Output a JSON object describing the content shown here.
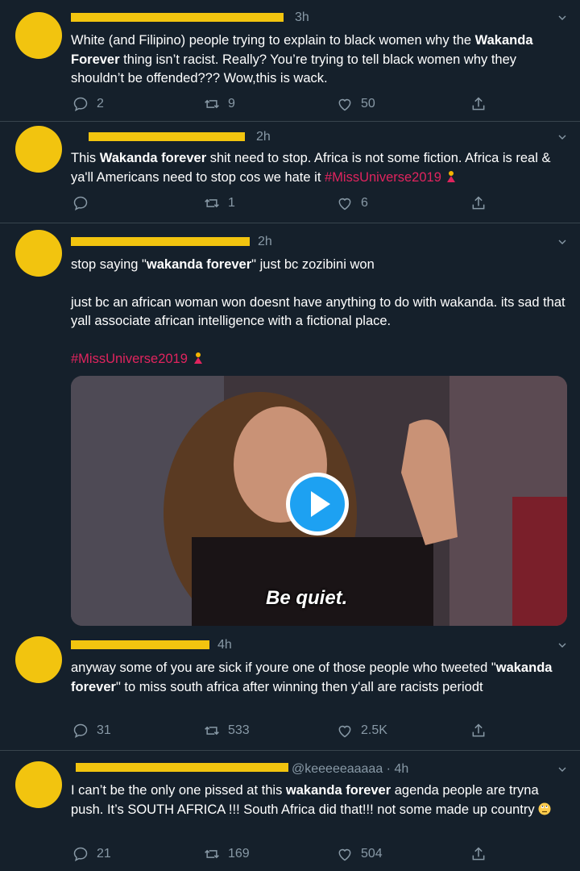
{
  "tweets": [
    {
      "time": "3h",
      "body_parts": [
        "White (and Filipino) people trying to explain to black women why the ",
        "Wakanda Forever",
        " thing isn’t racist. Really? You’re trying to tell black women why they shouldn’t be offended??? Wow,this is wack."
      ],
      "replies": "2",
      "retweets": "9",
      "likes": "50"
    },
    {
      "time": "2h",
      "body_parts": [
        "This ",
        "Wakanda forever",
        " shit need to stop. Africa is not some fiction. Africa is real & ya'll Americans need to stop cos we hate it ",
        "#MissUniverse2019"
      ],
      "replies": "",
      "retweets": "1",
      "likes": "6"
    },
    {
      "time": "2h",
      "line1_parts": [
        "stop saying \"",
        "wakanda forever",
        "\" just bc zozibini won"
      ],
      "para2": "just bc an african woman won doesnt have anything to do with wakanda. its sad that yall associate african intelligence with a fictional place.",
      "hashtag": "#MissUniverse2019",
      "media_caption": "Be quiet."
    },
    {
      "time": "4h",
      "body_parts": [
        "anyway some of you are sick if youre one of those people who tweeted \"",
        "wakanda forever",
        "\" to miss south africa after winning then y'all are racists periodt"
      ],
      "replies": "31",
      "retweets": "533",
      "likes": "2.5K"
    },
    {
      "handle_time": "@keeeeeaaaaa · 4h",
      "body_parts": [
        "I can’t be the only one pissed at this ",
        "wakanda forever",
        " agenda people are tryna push. It’s SOUTH AFRICA !!! South Africa did that!!! not some made up country"
      ],
      "replies": "21",
      "retweets": "169",
      "likes": "504"
    }
  ],
  "colors": {
    "background": "#15202b",
    "redaction": "#f2c40f",
    "hashtag": "#e0245e",
    "muted": "#8899a6",
    "play_button": "#1da1f2"
  },
  "icons": [
    "reply-icon",
    "retweet-icon",
    "like-icon",
    "share-icon",
    "chevron-down-icon",
    "play-icon"
  ]
}
